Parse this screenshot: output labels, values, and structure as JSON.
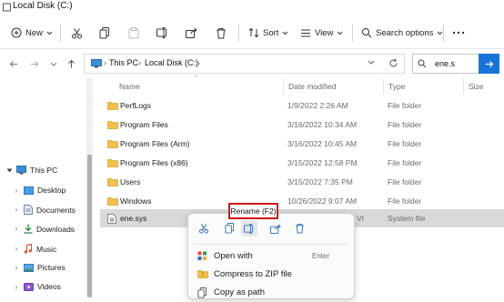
{
  "window": {
    "title": "Local Disk (C:)"
  },
  "toolbar": {
    "new_label": "New",
    "sort_label": "Sort",
    "view_label": "View",
    "search_options_label": "Search options"
  },
  "address": {
    "crumbs": [
      "This PC",
      "Local Disk (C:)"
    ]
  },
  "search": {
    "value": "ene.s"
  },
  "navpane": {
    "items": [
      {
        "label": "This PC",
        "expanded": true
      },
      {
        "label": "Desktop"
      },
      {
        "label": "Documents"
      },
      {
        "label": "Downloads"
      },
      {
        "label": "Music"
      },
      {
        "label": "Pictures"
      },
      {
        "label": "Videos"
      }
    ]
  },
  "columns": {
    "name": "Name",
    "date": "Date modified",
    "type": "Type",
    "size": "Size"
  },
  "files": [
    {
      "name": "PerfLogs",
      "date": "1/9/2022 2:26 AM",
      "type": "File folder"
    },
    {
      "name": "Program Files",
      "date": "3/16/2022 10:34 AM",
      "type": "File folder"
    },
    {
      "name": "Program Files (Arm)",
      "date": "3/16/2022 10:45 AM",
      "type": "File folder"
    },
    {
      "name": "Program Files (x86)",
      "date": "3/15/2022 12:58 PM",
      "type": "File folder"
    },
    {
      "name": "Users",
      "date": "3/15/2022 7:35 PM",
      "type": "File folder"
    },
    {
      "name": "Windows",
      "date": "10/26/2022 9:07 AM",
      "type": "File folder"
    },
    {
      "name": "ene.sys",
      "date": "VI",
      "type": "System file"
    }
  ],
  "context_menu": {
    "items": [
      {
        "label": "Open with",
        "key": "Enter"
      },
      {
        "label": "Compress to ZIP file",
        "key": ""
      },
      {
        "label": "Copy as path",
        "key": ""
      }
    ]
  },
  "tooltip": {
    "text": "Rename (F2)"
  },
  "colors": {
    "accent": "#1a73d9",
    "folder": "#f2c14e",
    "highlight": "#d01818"
  }
}
